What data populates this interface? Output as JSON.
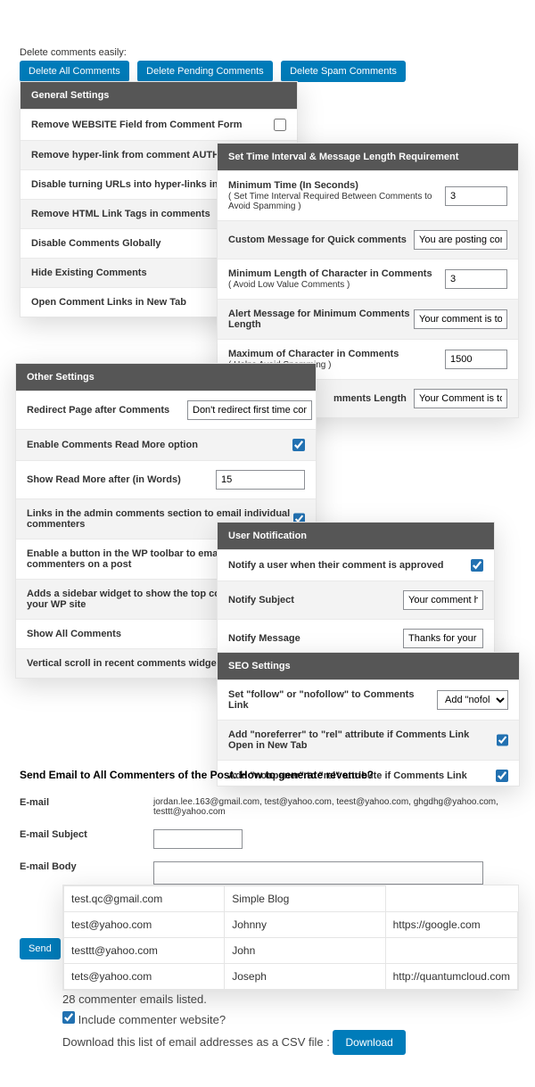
{
  "intro": "Delete comments easily:",
  "delButtons": [
    "Delete All Comments",
    "Delete Pending Comments",
    "Delete Spam Comments"
  ],
  "general": {
    "title": "General Settings",
    "rows": [
      {
        "label": "Remove WEBSITE Field from Comment Form",
        "check": false
      },
      {
        "label": "Remove hyper-link from comment AUTHOR Bio"
      },
      {
        "label": "Disable turning URLs into hyper-links in comments"
      },
      {
        "label": "Remove HTML Link Tags in comments"
      },
      {
        "label": "Disable Comments Globally"
      },
      {
        "label": "Hide Existing Comments"
      },
      {
        "label": "Open Comment Links in New Tab"
      }
    ]
  },
  "timing": {
    "title": "Set Time Interval & Message Length Requirement",
    "rows": [
      {
        "label": "Minimum Time (In Seconds)",
        "sub": "( Set Time Interval Required Between Comments to Avoid Spamming )",
        "value": "3"
      },
      {
        "label": "Custom Message for Quick comments",
        "value": "You are posting comments"
      },
      {
        "label": "Minimum Length of Character in Comments",
        "sub": "( Avoid Low Value Comments )",
        "value": "3"
      },
      {
        "label": "Alert Message for Minimum Comments Length",
        "value": "Your comment is too short."
      },
      {
        "label": "Maximum of Character in Comments",
        "sub": "( Helps Avoid Spamming )",
        "value": "1500"
      },
      {
        "label": "mments Length",
        "value": "Your Comment is too long.",
        "tail": true
      }
    ]
  },
  "other": {
    "title": "Other Settings",
    "rows": [
      {
        "label": "Redirect Page after Comments",
        "value": "Don't redirect first time commenter"
      },
      {
        "label": "Enable Comments Read More option",
        "check": true
      },
      {
        "label": "Show Read More after (in Words)",
        "value": "15",
        "narrow": true
      },
      {
        "label": "Links in the admin comments section to email individual commenters",
        "check": true
      },
      {
        "label": "Enable a button in the WP toolbar to email all the commenters on a post"
      },
      {
        "label": "Adds a sidebar widget to show the top commentators in your WP site"
      },
      {
        "label": "Show All Comments"
      },
      {
        "label": "Vertical scroll in recent comments widget"
      }
    ]
  },
  "notify": {
    "title": "User Notification",
    "rows": [
      {
        "label": "Notify a user when their comment is approved",
        "check": true
      },
      {
        "label": "Notify Subject",
        "value": "Your comment has bee"
      },
      {
        "label": "Notify Message",
        "value": "Thanks for your comme"
      }
    ]
  },
  "seo": {
    "title": "SEO Settings",
    "rows": [
      {
        "label": "Set \"follow\" or \"nofollow\" to Comments Link",
        "sel": "Add \"nofollow\""
      },
      {
        "label": "Add \"noreferrer\" to \"rel\" attribute if Comments Link Open in New Tab",
        "check": true
      },
      {
        "label": "Add \"noopener\" to \"rel\" attribute if Comments Link",
        "check": true,
        "cut": true
      }
    ]
  },
  "email": {
    "heading": "Send Email to All Commenters of the Post: How to generate revenue?",
    "fields": {
      "email": "E-mail",
      "emailVal": "jordan.lee.163@gmail.com, test@yahoo.com, teest@yahoo.com, ghgdhg@yahoo.com, testtt@yahoo.com",
      "subject": "E-mail Subject",
      "body": "E-mail Body",
      "send": "Send"
    }
  },
  "table": [
    [
      "test.qc@gmail.com",
      "Simple Blog",
      ""
    ],
    [
      "test@yahoo.com",
      "Johnny",
      "https://google.com"
    ],
    [
      "testtt@yahoo.com",
      "John",
      ""
    ],
    [
      "tets@yahoo.com",
      "Joseph",
      "http://quantumcloud.com"
    ]
  ],
  "footer": {
    "count": "28 commenter emails listed.",
    "include": "Include commenter website?",
    "dlText": "Download this list of email addresses as a CSV file :",
    "dlBtn": "Download"
  }
}
